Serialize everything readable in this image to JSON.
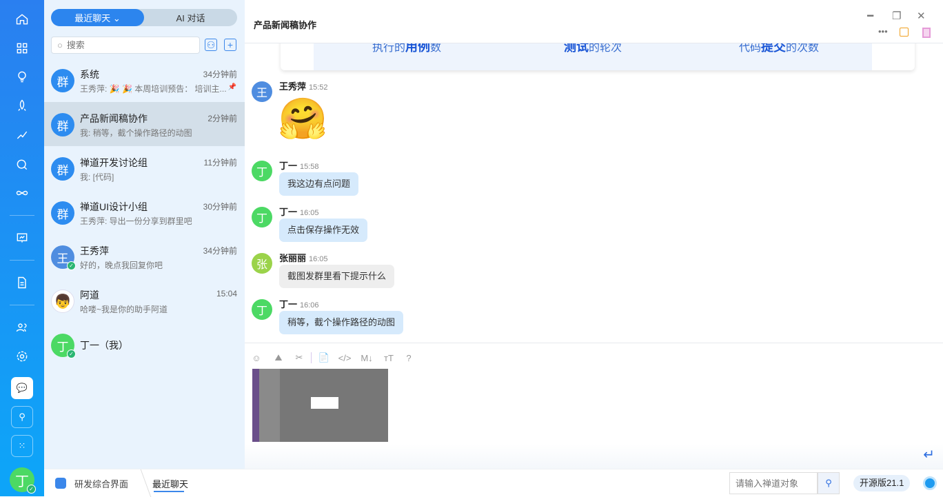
{
  "rail": {
    "user_avatar": "丁",
    "icons": [
      "home-icon",
      "apps-icon",
      "lightbulb-icon",
      "rocket-icon",
      "sprint-icon",
      "search-circle-icon",
      "infinity-icon",
      "board-icon",
      "document-icon",
      "team-icon",
      "settings-icon",
      "chat-icon",
      "contacts-icon",
      "grid-icon"
    ]
  },
  "list": {
    "tabs": [
      "最近聊天 ⌄",
      "AI 对话"
    ],
    "search_placeholder": "搜索",
    "items": [
      {
        "name": "系统",
        "time": "34分钟前",
        "msg": "王秀萍: 🎉 🎉 本周培训预告： 培训主...",
        "avatar": "群",
        "color": "#2d8cf0",
        "pinned": true
      },
      {
        "name": "产品新闻稿协作",
        "time": "2分钟前",
        "msg": "我: 稍等，截个操作路径的动图",
        "avatar": "群",
        "color": "#2d8cf0"
      },
      {
        "name": "禅道开发讨论组",
        "time": "11分钟前",
        "msg": "我: [代码]",
        "avatar": "群",
        "color": "#2d8cf0"
      },
      {
        "name": "禅道UI设计小组",
        "time": "30分钟前",
        "msg": "王秀萍: 导出一份分享到群里吧",
        "avatar": "群",
        "color": "#2d8cf0"
      },
      {
        "name": "王秀萍",
        "time": "34分钟前",
        "msg": "好的，晚点我回复你吧",
        "avatar": "王",
        "color": "#4f8de0",
        "online": true
      },
      {
        "name": "阿道",
        "time": "15:04",
        "msg": "哈喽~我是你的助手阿道",
        "avatar": "",
        "color": "#fff"
      },
      {
        "name": "丁一（我）",
        "time": "",
        "msg": "",
        "avatar": "丁",
        "color": "#4cd964",
        "online": true
      }
    ]
  },
  "chat": {
    "title": "产品新闻稿协作",
    "card": [
      {
        "a": "执行的",
        "b": "用例",
        "c": "数"
      },
      {
        "a": "",
        "b": "测试",
        "c": "的轮次"
      },
      {
        "a": "代码",
        "b": "提交",
        "c": "的次数"
      }
    ],
    "messages": [
      {
        "name": "王秀萍",
        "time": "15:52",
        "avatar": "王",
        "color": "#4f8de0",
        "text": "🤗",
        "emoji": true
      },
      {
        "name": "丁一",
        "time": "15:58",
        "avatar": "丁",
        "color": "#4cd964",
        "text": "我这边有点问题"
      },
      {
        "name": "丁一",
        "time": "16:05",
        "avatar": "丁",
        "color": "#4cd964",
        "text": "点击保存操作无效"
      },
      {
        "name": "张丽丽",
        "time": "16:05",
        "avatar": "张",
        "color": "#9bd34a",
        "text": "截图发群里看下提示什么",
        "gray": true
      },
      {
        "name": "丁一",
        "time": "16:06",
        "avatar": "丁",
        "color": "#4cd964",
        "text": "稍等，截个操作路径的动图"
      }
    ],
    "toolbar": [
      "☺",
      "⛰",
      "✂",
      "📄",
      "</>",
      "M↓",
      "ᴛT",
      "?"
    ]
  },
  "bottom": {
    "app": "研发综合界面",
    "crumb": "最近聊天",
    "search_placeholder": "请输入禅道对象",
    "version": "开源版21.1"
  }
}
